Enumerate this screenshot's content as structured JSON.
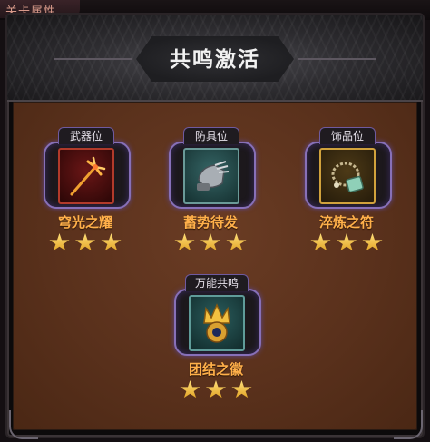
{
  "top_tab": {
    "label": "关卡属性"
  },
  "dialog": {
    "title": "共鸣激活"
  },
  "slots": [
    {
      "tag": "武器位",
      "name": "穹光之耀",
      "stars": 3,
      "icon": "trident-icon",
      "frame_color": "#b23a2a"
    },
    {
      "tag": "防具位",
      "name": "蓄势待发",
      "stars": 3,
      "icon": "gauntlet-icon",
      "frame_color": "#6a9a98"
    },
    {
      "tag": "饰品位",
      "name": "淬炼之符",
      "stars": 3,
      "icon": "bead-talisman-icon",
      "frame_color": "#d1a23c"
    },
    {
      "tag": "万能共鸣",
      "name": "团结之徽",
      "stars": 3,
      "icon": "crown-emblem-icon",
      "frame_color": "#5f9c99"
    }
  ],
  "colors": {
    "panel": "#5a311c",
    "slot_ring": "#8770b8",
    "name_text": "#ffb04a",
    "star": "#f2c040"
  }
}
